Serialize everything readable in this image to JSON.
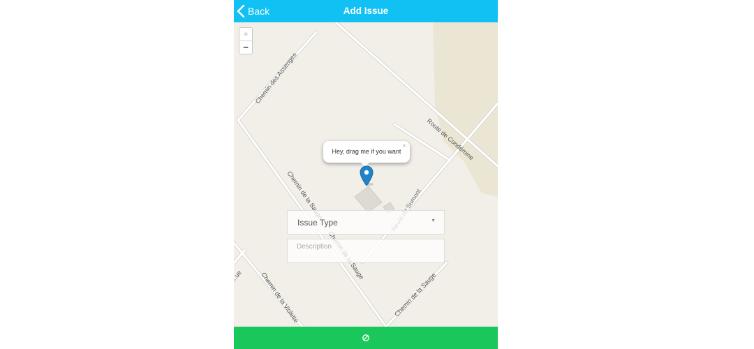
{
  "header": {
    "back_label": "Back",
    "title": "Add Issue",
    "color": "#11c1f3"
  },
  "map": {
    "zoom_in_label": "+",
    "zoom_out_label": "−",
    "popup": {
      "text": "Hey, drag me if you want",
      "close": "×"
    },
    "streets": [
      "Chemin des Assenges",
      "Route de Condémine",
      "Chemin de la Sauge",
      "Chemin de la Sauge",
      "Route de Sumont",
      "Chemin de la Sauge",
      "Chemin de la Violette",
      "...ue"
    ],
    "marker_color": "#1f84c8"
  },
  "form": {
    "issue_type_label": "Issue Type",
    "description_placeholder": "Description"
  },
  "footer": {
    "icon": "locate-icon",
    "color": "#19c75a"
  }
}
